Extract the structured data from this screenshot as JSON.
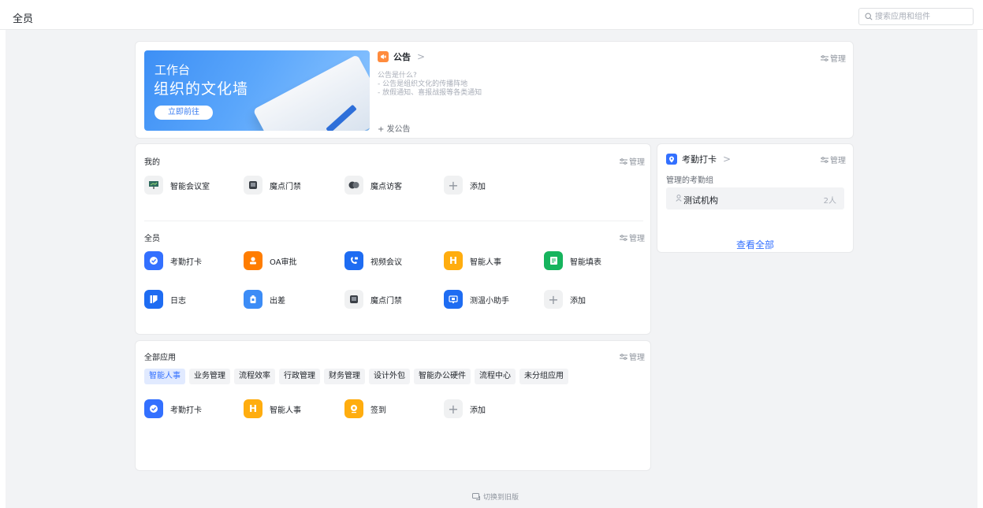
{
  "topbar": {
    "org_name": "全员",
    "search_placeholder": "搜索应用和组件"
  },
  "banner": {
    "subtitle": "工作台",
    "title": "组织的文化墙",
    "button": "立即前往"
  },
  "notice": {
    "title": "公告",
    "intro": "公告是什么?",
    "line1": "- 公告是组织文化的传播阵地",
    "line2": "- 放假通知、喜报战报等各类通知",
    "post": "+ 发公告",
    "manage": "管理"
  },
  "mine": {
    "title": "我的",
    "manage": "管理",
    "apps": [
      {
        "label": "智能会议室",
        "icon": "meeting-room-icon",
        "color": "#f0f1f2"
      },
      {
        "label": "魔点门禁",
        "icon": "door-access-icon",
        "color": "#f0f1f2"
      },
      {
        "label": "魔点访客",
        "icon": "visitor-icon",
        "color": "#f0f1f2"
      },
      {
        "label": "添加",
        "icon": "plus-icon",
        "color": "#f0f1f2"
      }
    ]
  },
  "all_staff": {
    "title": "全员",
    "manage": "管理",
    "apps": [
      {
        "label": "考勤打卡",
        "icon": "attendance-icon",
        "color": "#3370ff"
      },
      {
        "label": "OA审批",
        "icon": "approval-icon",
        "color": "#ff7d00"
      },
      {
        "label": "视频会议",
        "icon": "video-call-icon",
        "color": "#1e6cf2"
      },
      {
        "label": "智能人事",
        "icon": "hr-icon",
        "color": "#ffad0f"
      },
      {
        "label": "智能填表",
        "icon": "form-icon",
        "color": "#16b45d"
      },
      {
        "label": "日志",
        "icon": "log-icon",
        "color": "#1e6cf2"
      },
      {
        "label": "出差",
        "icon": "business-trip-icon",
        "color": "#3c8cf6"
      },
      {
        "label": "魔点门禁",
        "icon": "door-access-icon",
        "color": "#f0f1f2"
      },
      {
        "label": "测温小助手",
        "icon": "temperature-icon",
        "color": "#1e6cf2"
      },
      {
        "label": "添加",
        "icon": "plus-icon",
        "color": "#f0f1f2"
      }
    ]
  },
  "all_apps": {
    "title": "全部应用",
    "manage": "管理",
    "tabs": [
      "智能人事",
      "业务管理",
      "流程效率",
      "行政管理",
      "财务管理",
      "设计外包",
      "智能办公硬件",
      "流程中心",
      "未分组应用"
    ],
    "active_tab": "智能人事",
    "apps": [
      {
        "label": "考勤打卡",
        "icon": "attendance-icon",
        "color": "#3370ff"
      },
      {
        "label": "智能人事",
        "icon": "hr-icon",
        "color": "#ffad0f"
      },
      {
        "label": "签到",
        "icon": "checkin-icon",
        "color": "#ffad0f"
      },
      {
        "label": "添加",
        "icon": "plus-icon",
        "color": "#f0f1f2"
      }
    ]
  },
  "attendance_widget": {
    "title": "考勤打卡",
    "manage": "管理",
    "subtitle": "管理的考勤组",
    "group_name": "测试机构",
    "group_count": "2人",
    "view_all": "查看全部"
  },
  "footer": {
    "switch_label": "切换到旧版"
  }
}
